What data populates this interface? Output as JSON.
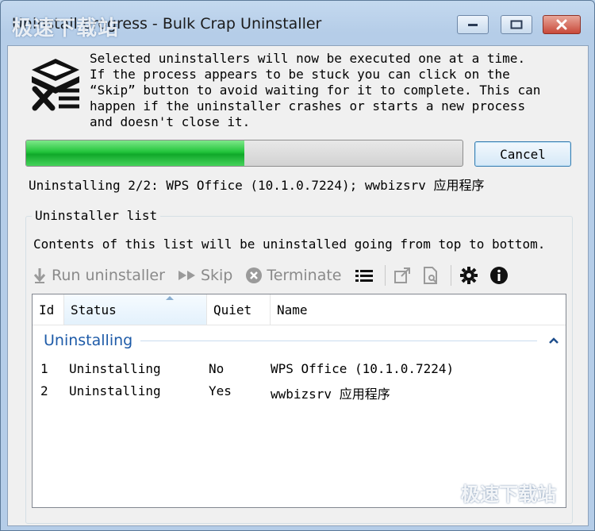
{
  "window": {
    "title": "Uninstall progress - Bulk Crap Uninstaller",
    "watermark_top": "极速下载站",
    "watermark_bottom": "极速下载站"
  },
  "intro_text": "Selected uninstallers will now be executed one at a time.\nIf the process appears to be stuck you can click on the\n“Skip” button to avoid waiting for it to complete. This can\nhappen if the uninstaller crashes or starts a new process\nand doesn't close it.",
  "progress": {
    "fraction": 0.5
  },
  "cancel_label": "Cancel",
  "status_line": "Uninstalling 2/2: WPS Office (10.1.0.7224); wwbizsrv 应用程序",
  "uninstaller_list": {
    "group_label": "Uninstaller list",
    "description": "Contents of this list will be uninstalled going from top to bottom.",
    "toolbar": {
      "run_label": "Run uninstaller",
      "skip_label": "Skip",
      "terminate_label": "Terminate"
    },
    "columns": [
      "Id",
      "Status",
      "Quiet",
      "Name"
    ],
    "group_name": "Uninstalling",
    "rows": [
      {
        "id": "1",
        "status": "Uninstalling",
        "quiet": "No",
        "name": "WPS Office (10.1.0.7224)"
      },
      {
        "id": "2",
        "status": "Uninstalling",
        "quiet": "Yes",
        "name": "wwbizsrv 应用程序"
      }
    ]
  },
  "colors": {
    "progress_green": "#22c43b",
    "group_blue": "#1e5ba8",
    "close_red": "#c8493a"
  }
}
